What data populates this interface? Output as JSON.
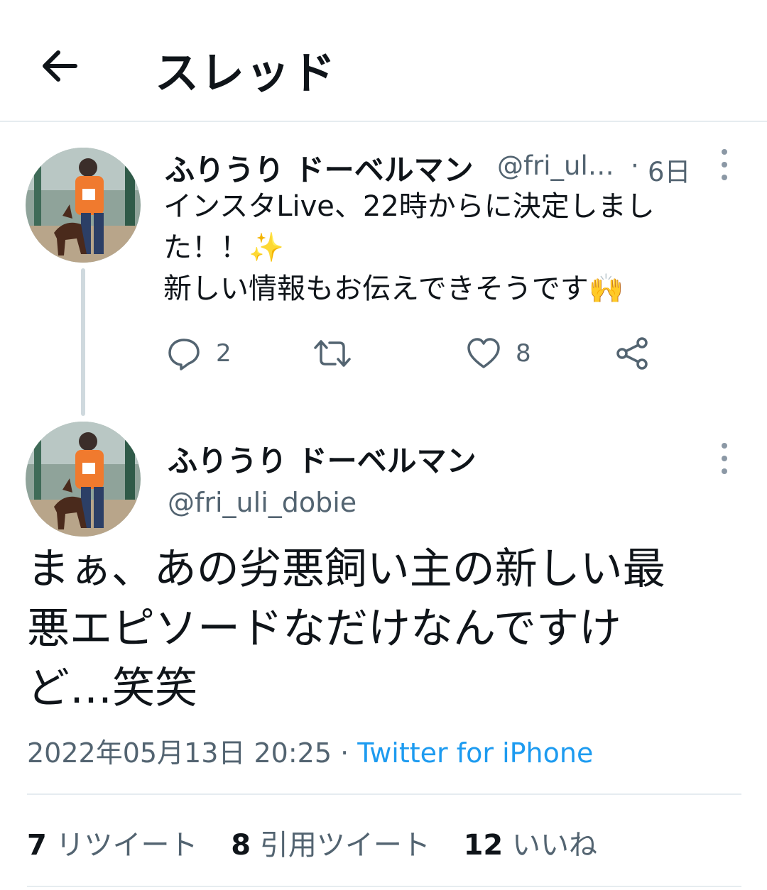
{
  "header": {
    "title": "スレッド"
  },
  "thread_tweet": {
    "name": "ふりうり ドーベルマン",
    "handle": "@fri_ul…",
    "separator": "·",
    "time": "6日",
    "body_lines": [
      "インスタLive、22時からに決定しまし",
      "た！！✨",
      "新しい情報もお伝えできそうです🙌"
    ],
    "reply_count": "2",
    "like_count": "8"
  },
  "main_tweet": {
    "name": "ふりうり ドーベルマン",
    "handle": "@fri_uli_dobie",
    "body_lines": [
      "まぁ、あの劣悪飼い主の新しい最",
      "悪エピソードなだけなんですけ",
      "ど…笑笑"
    ],
    "timestamp": "2022年05月13日 20:25",
    "separator": "·",
    "source": "Twitter for iPhone",
    "retweets_count": "7",
    "retweets_label": "リツイート",
    "quotes_count": "8",
    "quotes_label": "引用ツイート",
    "likes_count": "12",
    "likes_label": "いいね"
  },
  "colors": {
    "accent": "#1d9bf0",
    "secondary_text": "#536471",
    "orange_shirt": "#f07a2e"
  }
}
